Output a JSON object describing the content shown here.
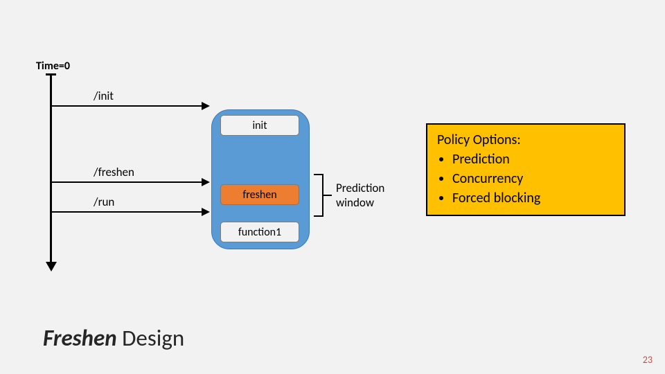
{
  "time_label": "Time=0",
  "calls": {
    "init": "/init",
    "freshen": "/freshen",
    "run": "/run"
  },
  "boxes": {
    "init": "init",
    "freshen": "freshen",
    "function1": "function1"
  },
  "prediction_label_line1": "Prediction",
  "prediction_label_line2": "window",
  "policy": {
    "heading": "Policy Options:",
    "items": [
      "Prediction",
      "Concurrency",
      "Forced blocking"
    ]
  },
  "title_em": "Freshen",
  "title_rest": " Design",
  "page_number": "23",
  "chart_data": {
    "type": "table",
    "description": "Sequence diagram of Freshen Design. A vertical timeline from Time=0 downward. API calls /init, /freshen, /run arrive in order and map into stages init, freshen, function1 running inside a process. A Prediction window brackets the freshen stage. A side panel lists policy options.",
    "timeline_calls": [
      "/init",
      "/freshen",
      "/run"
    ],
    "stages": [
      "init",
      "freshen",
      "function1"
    ],
    "prediction_window_over": "freshen",
    "policy_options": [
      "Prediction",
      "Concurrency",
      "Forced blocking"
    ]
  }
}
